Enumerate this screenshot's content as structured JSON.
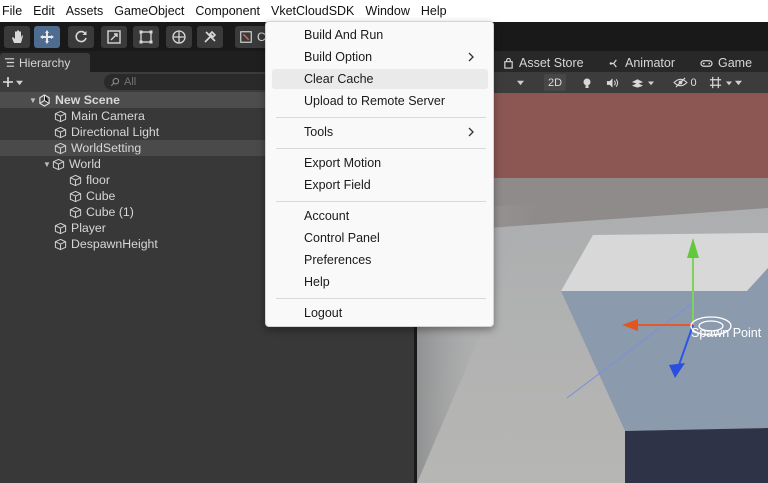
{
  "menubar": {
    "items": [
      "File",
      "Edit",
      "Assets",
      "GameObject",
      "Component",
      "VketCloudSDK",
      "Window",
      "Help"
    ]
  },
  "toolbar": {
    "tools": [
      "hand-tool",
      "move-tool",
      "rotate-tool",
      "scale-tool",
      "rect-tool",
      "transform-tool",
      "custom-tool"
    ],
    "pivot_label": "C"
  },
  "hierarchy": {
    "tab_label": "Hierarchy",
    "search_placeholder": "All",
    "scene_name": "New Scene",
    "items": [
      "Main Camera",
      "Directional Light",
      "WorldSetting",
      "World",
      "floor",
      "Cube",
      "Cube (1)",
      "Player",
      "DespawnHeight"
    ]
  },
  "right_tabs": {
    "asset_store": "Asset Store",
    "animator": "Animator",
    "game": "Game"
  },
  "scene_toolbar": {
    "mode_2d": "2D",
    "hidden_count": "0"
  },
  "scene": {
    "spawn_label": "Spawn Point"
  },
  "dropdown": {
    "items": [
      "Build And Run",
      "Build Option",
      "Clear Cache",
      "Upload to Remote Server",
      "Tools",
      "Export Motion",
      "Export Field",
      "Account",
      "Control Panel",
      "Preferences",
      "Help",
      "Logout"
    ],
    "hovered": "Clear Cache"
  },
  "colors": {
    "accent": "#4e6c8f",
    "sky": "#8c5653",
    "selection": "#4a4a4a"
  }
}
